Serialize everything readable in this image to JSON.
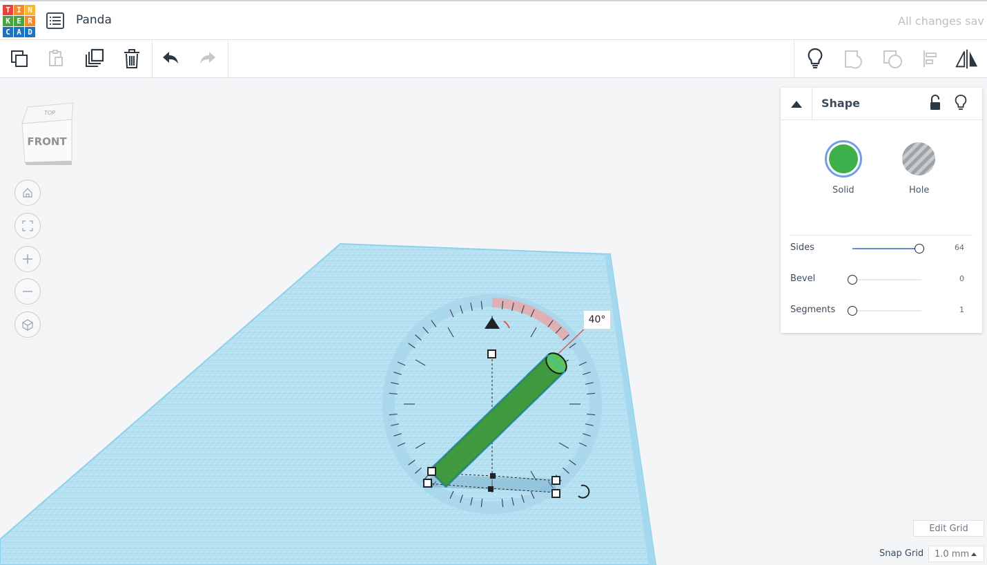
{
  "header": {
    "logo_letters": [
      "T",
      "I",
      "N",
      "K",
      "E",
      "R",
      "C",
      "A",
      "D"
    ],
    "logo_colors": [
      "#e8423c",
      "#f28a2f",
      "#f7b731",
      "#4aa342",
      "#4aa342",
      "#f28a2f",
      "#1e73be",
      "#1e73be",
      "#1e73be"
    ],
    "project_name": "Panda",
    "save_status": "All changes sav"
  },
  "toolbar": {
    "left_tools": [
      "copy-icon",
      "paste-icon",
      "duplicate-icon",
      "delete-icon",
      "undo-icon",
      "redo-icon"
    ],
    "right_tools": [
      "lightbulb-icon",
      "group-icon",
      "ungroup-icon",
      "align-icon",
      "mirror-icon"
    ]
  },
  "viewcube": {
    "top_label": "TOP",
    "front_label": "FRONT"
  },
  "workplane": {
    "rotation_angle": "40°",
    "grid_color": "#a9daf0",
    "shape_color": "#3cb04a"
  },
  "inspector": {
    "title": "Shape",
    "solid_label": "Solid",
    "hole_label": "Hole",
    "props": [
      {
        "label": "Sides",
        "value": "64",
        "fraction": 0.97
      },
      {
        "label": "Bevel",
        "value": "0",
        "fraction": 0.0
      },
      {
        "label": "Segments",
        "value": "1",
        "fraction": 0.0
      }
    ]
  },
  "grid_controls": {
    "edit_grid": "Edit Grid",
    "snap_label": "Snap Grid",
    "snap_value": "1.0 mm"
  }
}
